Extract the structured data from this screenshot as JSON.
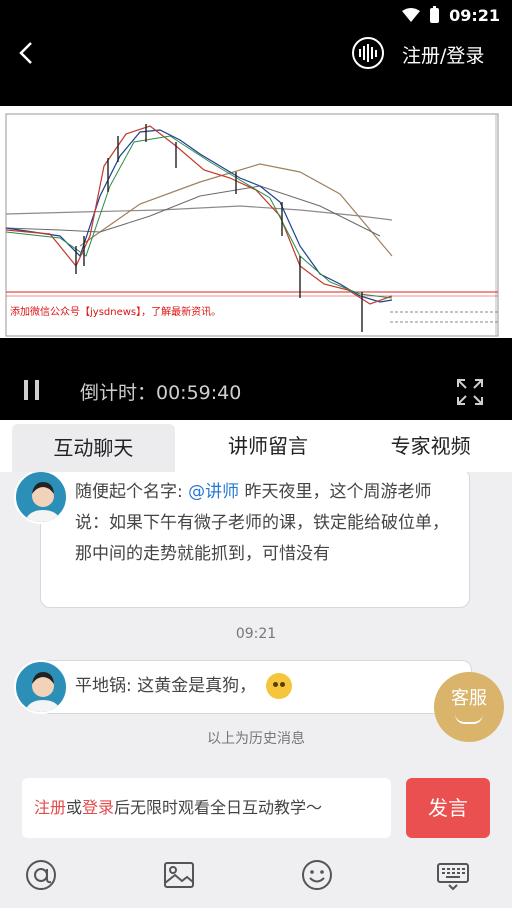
{
  "status": {
    "time": "09:21"
  },
  "header": {
    "login_label": "注册/登录"
  },
  "video": {
    "overlay": "添加微信公众号【jysdnews】，了解最新资讯。",
    "countdown": "倒计时：00:59:40"
  },
  "tabs": [
    {
      "label": "互动聊天"
    },
    {
      "label": "讲师留言"
    },
    {
      "label": "专家视频"
    }
  ],
  "chat": {
    "msg1": {
      "name": "随便起个名字:",
      "mention": "@讲师",
      "text": "昨天夜里，这个周游老师说：如果下午有微子老师的课，铁定能给破位单，那中间的走势就能抓到，可惜没有"
    },
    "time": "09:21",
    "msg2": {
      "text": "平地锅: 这黄金是真狗，"
    },
    "history": "以上为历史消息",
    "service": "客服"
  },
  "input": {
    "register": "注册",
    "or": "或",
    "login": "登录",
    "rest": "后无限时观看全日互动教学～",
    "send": "发言"
  },
  "colors": {
    "accent_red": "#e9504f",
    "mention_blue": "#2a78d4",
    "service_gold": "#d9b46a"
  }
}
